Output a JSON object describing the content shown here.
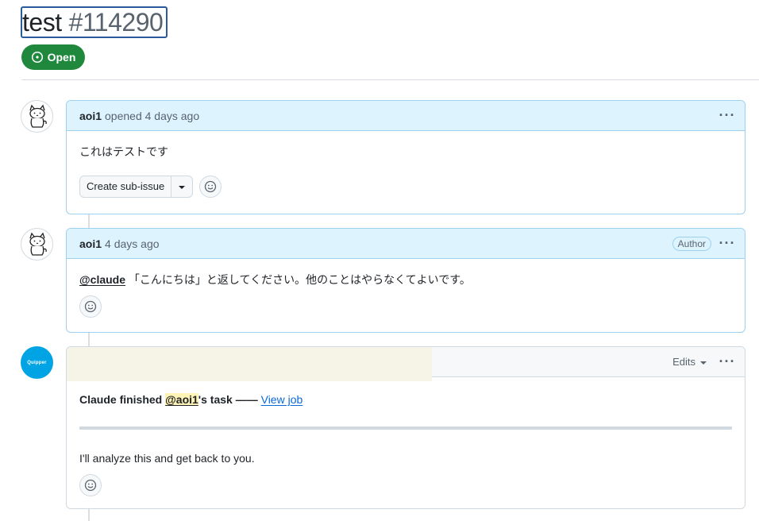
{
  "issue": {
    "title": "test",
    "number": "#114290",
    "state": "Open"
  },
  "comments": [
    {
      "author": "aoi1",
      "meta": "opened 4 days ago",
      "body": "これはテストです",
      "sub_issue_label": "Create sub-issue"
    },
    {
      "author": "aoi1",
      "meta": "4 days ago",
      "badge": "Author",
      "mention": "@claude",
      "body_rest": " 「こんにちは」と返してください。他のことはやらなくてよいです。"
    },
    {
      "avatar_text": "Quipper",
      "edits_label": "Edits",
      "status_prefix": "Claude finished ",
      "status_mention": "@aoi1",
      "status_suffix": "'s task —— ",
      "status_link": "View job",
      "body": "I'll analyze this and get back to you."
    }
  ],
  "colors": {
    "open_green": "#1f883d",
    "header_blue": "#ddf4ff",
    "quipper_blue": "#00a4e4",
    "link_blue": "#0969da"
  },
  "icons": {
    "state": "issue-opened-icon",
    "menu": "kebab-horizontal-icon",
    "reaction": "smiley-icon",
    "dropdown": "triangle-down-icon"
  }
}
